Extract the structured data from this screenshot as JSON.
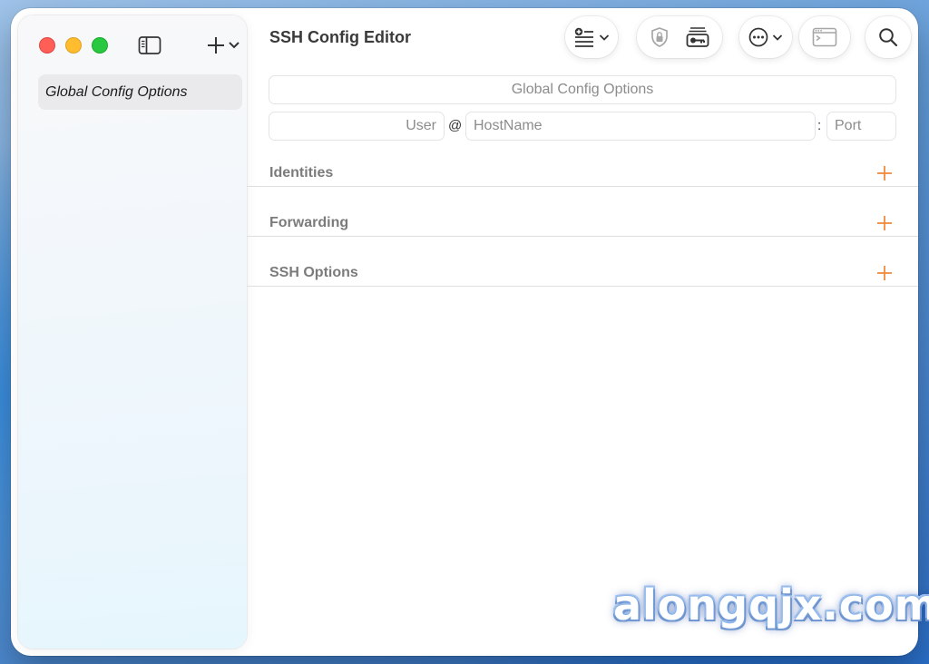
{
  "window": {
    "title": "SSH Config Editor"
  },
  "sidebar": {
    "items": [
      {
        "label": "Global Config Options",
        "selected": true
      }
    ],
    "toggle_icon": "sidebar-icon",
    "add_icon": "plus-icon"
  },
  "toolbar": {
    "buttons": [
      {
        "name": "list-add-menu",
        "icon": "list-plus-icon"
      },
      {
        "name": "security-shield",
        "icon": "shield-icon"
      },
      {
        "name": "keychain",
        "icon": "key-card-icon"
      },
      {
        "name": "more-menu",
        "icon": "ellipsis-circle-icon"
      },
      {
        "name": "terminal",
        "icon": "terminal-window-icon"
      },
      {
        "name": "search",
        "icon": "search-icon"
      }
    ]
  },
  "main": {
    "host_field_placeholder": "Global Config Options",
    "user_placeholder": "User",
    "at_sign": "@",
    "hostname_placeholder": "HostName",
    "colon": ":",
    "port_placeholder": "Port",
    "sections": [
      {
        "label": "Identities"
      },
      {
        "label": "Forwarding"
      },
      {
        "label": "SSH Options"
      }
    ]
  },
  "watermark": "alongqjx.com",
  "colors": {
    "accent": "#f08a3c",
    "close": "#ff5f57",
    "minimize": "#febc2e",
    "maximize": "#28c840"
  }
}
